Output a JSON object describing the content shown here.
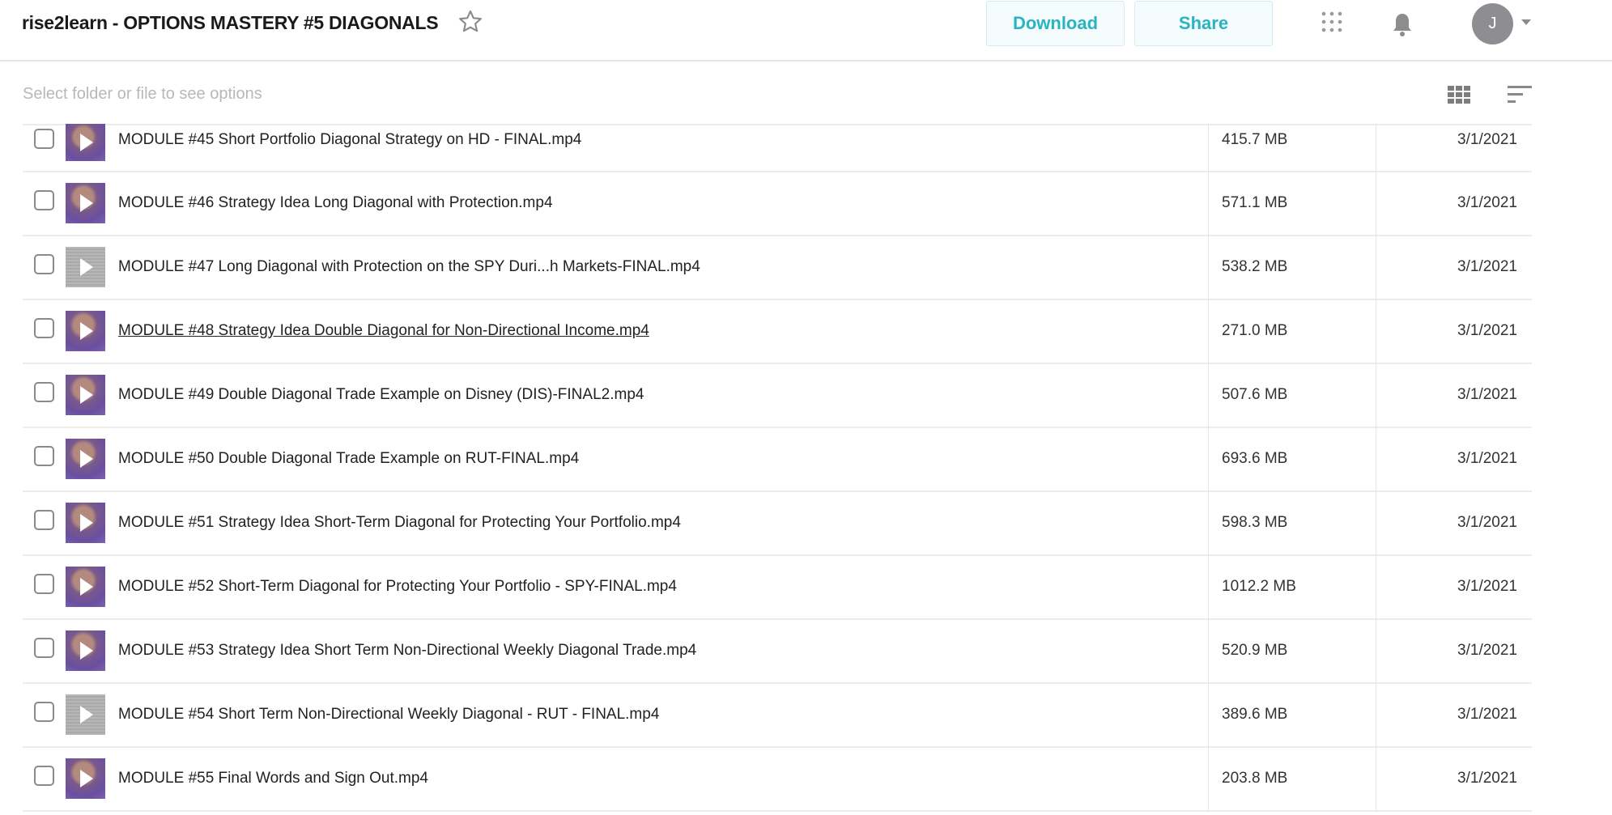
{
  "header": {
    "title": "rise2learn - OPTIONS MASTERY #5 DIAGONALS",
    "star_icon": "star-outline-icon",
    "download_label": "Download",
    "share_label": "Share",
    "apps_icon": "apps-grid-icon",
    "bell_icon": "bell-icon",
    "avatar_initial": "J",
    "accent_color": "#2bb3c0"
  },
  "toolbar": {
    "hint": "Select folder or file to see options",
    "grid_view_icon": "grid-view-icon",
    "sort_icon": "sort-icon"
  },
  "files": [
    {
      "name": "MODULE #45 Short Portfolio Diagonal Strategy on HD - FINAL.mp4",
      "size": "415.7 MB",
      "date": "3/1/2021",
      "thumb": "purple",
      "underlined": false
    },
    {
      "name": "MODULE #46 Strategy Idea Long Diagonal with Protection.mp4",
      "size": "571.1 MB",
      "date": "3/1/2021",
      "thumb": "purple",
      "underlined": false
    },
    {
      "name": "MODULE #47 Long Diagonal with Protection on the SPY Duri...h Markets-FINAL.mp4",
      "size": "538.2 MB",
      "date": "3/1/2021",
      "thumb": "gray",
      "underlined": false
    },
    {
      "name": "MODULE #48 Strategy Idea Double Diagonal for Non-Directional Income.mp4",
      "size": "271.0 MB",
      "date": "3/1/2021",
      "thumb": "purple",
      "underlined": true
    },
    {
      "name": "MODULE #49 Double Diagonal Trade Example on Disney (DIS)-FINAL2.mp4",
      "size": "507.6 MB",
      "date": "3/1/2021",
      "thumb": "purple",
      "underlined": false
    },
    {
      "name": "MODULE #50 Double Diagonal Trade Example on RUT-FINAL.mp4",
      "size": "693.6 MB",
      "date": "3/1/2021",
      "thumb": "purple",
      "underlined": false
    },
    {
      "name": "MODULE #51 Strategy Idea Short-Term Diagonal for Protecting Your Portfolio.mp4",
      "size": "598.3 MB",
      "date": "3/1/2021",
      "thumb": "purple",
      "underlined": false
    },
    {
      "name": "MODULE #52 Short-Term Diagonal for Protecting Your Portfolio - SPY-FINAL.mp4",
      "size": "1012.2 MB",
      "date": "3/1/2021",
      "thumb": "purple",
      "underlined": false
    },
    {
      "name": "MODULE #53 Strategy Idea Short Term Non-Directional Weekly Diagonal Trade.mp4",
      "size": "520.9 MB",
      "date": "3/1/2021",
      "thumb": "purple",
      "underlined": false
    },
    {
      "name": "MODULE #54 Short Term Non-Directional Weekly Diagonal - RUT - FINAL.mp4",
      "size": "389.6 MB",
      "date": "3/1/2021",
      "thumb": "gray",
      "underlined": false
    },
    {
      "name": "MODULE #55 Final Words and Sign Out.mp4",
      "size": "203.8 MB",
      "date": "3/1/2021",
      "thumb": "purple",
      "underlined": false
    }
  ]
}
